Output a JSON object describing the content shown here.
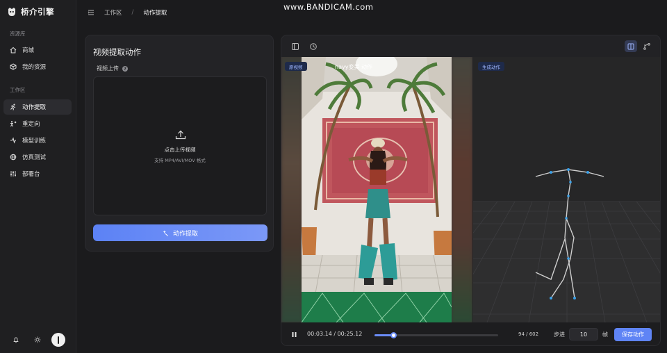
{
  "app": {
    "brand_name": "桥介引擎"
  },
  "watermark": "www.BANDICAM.com",
  "sidebar": {
    "sections": [
      {
        "label": "资源库"
      },
      {
        "label": "工作区"
      }
    ],
    "items": [
      {
        "label": "商城",
        "icon": "home-icon"
      },
      {
        "label": "我的资源",
        "icon": "box-icon"
      },
      {
        "label": "动作提取",
        "icon": "running-icon",
        "active": true
      },
      {
        "label": "重定向",
        "icon": "retarget-icon"
      },
      {
        "label": "模型训练",
        "icon": "train-icon"
      },
      {
        "label": "仿真测试",
        "icon": "globe-icon"
      },
      {
        "label": "部署台",
        "icon": "sliders-icon"
      }
    ]
  },
  "breadcrumb": {
    "root": "工作区",
    "separator": "/",
    "current": "动作提取"
  },
  "left_panel": {
    "title": "视频提取动作",
    "upload_label": "视频上传",
    "help_glyph": "?",
    "dropzone_main": "点击上传视频",
    "dropzone_sub": "支持 MP4/AVI/MOV 格式",
    "extract_button": "动作提取"
  },
  "right_panel": {
    "source_tag": "原视频",
    "generated_tag": "生成动作",
    "video_overlay_text": "hayy变美 动作",
    "player": {
      "time": "00:03.14 / 00:25.12",
      "progress": 0.156,
      "frames": "94 / 602",
      "step_label": "步进",
      "step_value": "10",
      "frame_unit": "帧",
      "save_button": "保存动作"
    }
  },
  "colors": {
    "accent": "#5f84f5",
    "tag_text": "#9fb7ff",
    "skeleton_joint": "#3aa0e8"
  }
}
